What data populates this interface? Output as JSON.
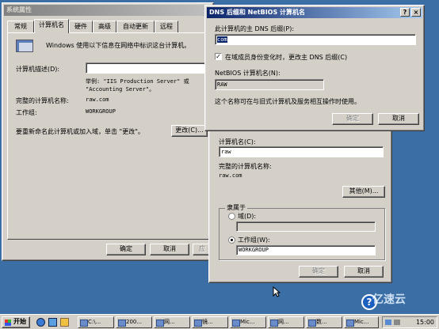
{
  "sysprops": {
    "title": "系统属性",
    "tabs": [
      "常规",
      "计算机名",
      "硬件",
      "高级",
      "自动更新",
      "远程"
    ],
    "intro": "Windows 使用以下信息在网络中标识这台计算机。",
    "desc_label": "计算机描述(D):",
    "example": "举例: \"IIS Production Server\" 或\n\"Accounting Server\"。",
    "fullname_label": "完整的计算机名称:",
    "fullname_value": "raw.com",
    "workgroup_label": "工作组:",
    "workgroup_value": "WORKGROUP",
    "rename_text": "要重新命名此计算机或加入域，单击 \"更改\"。",
    "change_button": "更改(C)...",
    "ok": "确定",
    "cancel": "取消",
    "apply": "应"
  },
  "change_dialog": {
    "name_label": "计算机名(C):",
    "name_value": "raw",
    "fullname_label": "完整的计算机名称:",
    "fullname_value": "raw.com",
    "other_button": "其他(M)...",
    "member_group": "隶属于",
    "domain_label": "域(D):",
    "workgroup_label": "工作组(W):",
    "workgroup_value": "WORKGROUP",
    "ok": "确定",
    "cancel": "取消"
  },
  "dns_dialog": {
    "title": "DNS 后缀和 NetBIOS 计算机名",
    "help_glyph": "?",
    "close_glyph": "×",
    "suffix_label": "此计算机的主 DNS 后缀(P):",
    "suffix_value": "com",
    "change_checkbox": "在域成员身份变化时，更改主 DNS 后缀(C)",
    "netbios_label": "NetBIOS 计算机名(N):",
    "netbios_value": "RAW",
    "info": "这个名称可在与旧式计算机及服务相互操作时使用。",
    "ok": "确定",
    "cancel": "取消"
  },
  "taskbar": {
    "start": "开始",
    "items": [
      "C:\\...",
      "200...",
      "网...",
      "镜...",
      "Mic...",
      "网...",
      "数...",
      "Mic..."
    ],
    "clock": "15:00"
  },
  "watermark": "亿速云"
}
